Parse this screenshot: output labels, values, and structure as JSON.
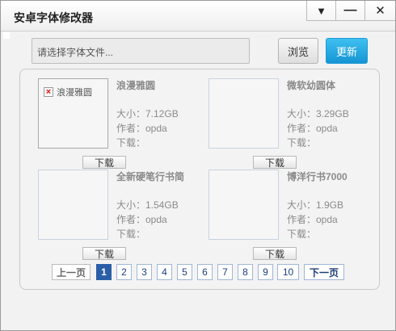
{
  "window": {
    "title": "安卓字体修改器",
    "controls": {
      "menu": "▼",
      "minimize": "—",
      "close": "✕"
    }
  },
  "toolbar": {
    "file_placeholder": "请选择字体文件...",
    "browse_label": "浏览",
    "update_label": "更新"
  },
  "fonts": [
    {
      "name": "浪漫雅圆",
      "size": "大小：7.12GB",
      "author": "作者：opda",
      "download": "下载：",
      "preview_text": "浪漫雅圆",
      "download_btn": "下载"
    },
    {
      "name": "微软幼圆体",
      "size": "大小：3.29GB",
      "author": "作者：opda",
      "download": "下载：",
      "download_btn": "下载"
    },
    {
      "name": "全新硬笔行书简",
      "size": "大小：1.54GB",
      "author": "作者：opda",
      "download": "下载：",
      "download_btn": "下载"
    },
    {
      "name": "博洋行书7000",
      "size": "大小：1.9GB",
      "author": "作者：opda",
      "download": "下载：",
      "download_btn": "下载"
    }
  ],
  "pagination": {
    "prev": "上一页",
    "pages": [
      "1",
      "2",
      "3",
      "4",
      "5",
      "6",
      "7",
      "8",
      "9",
      "10"
    ],
    "current": "1",
    "next": "下一页"
  },
  "icons": {
    "broken_image": "broken-image-icon"
  },
  "colors": {
    "accent": "#1595d3",
    "active_page": "#2a5fa8"
  }
}
